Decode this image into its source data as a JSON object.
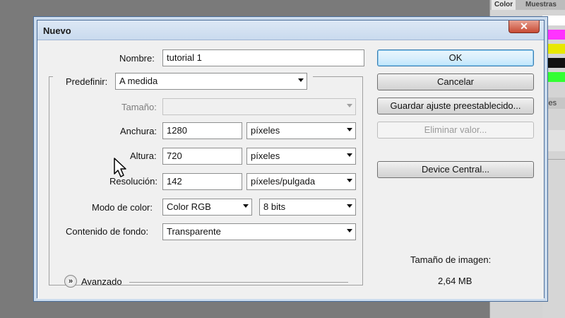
{
  "background_app": {
    "tabs": [
      "Color",
      "Muestras"
    ],
    "side_tab": "ales"
  },
  "dialog": {
    "title": "Nuevo",
    "close_symbol": "✕",
    "name": {
      "label": "Nombre:",
      "value": "tutorial 1"
    },
    "preset": {
      "label": "Predefinir:",
      "value": "A medida"
    },
    "size": {
      "label": "Tamaño:",
      "value": ""
    },
    "width": {
      "label": "Anchura:",
      "value": "1280",
      "unit": "píxeles"
    },
    "height": {
      "label": "Altura:",
      "value": "720",
      "unit": "píxeles"
    },
    "resolution": {
      "label": "Resolución:",
      "value": "142",
      "unit": "píxeles/pulgada"
    },
    "color_mode": {
      "label": "Modo de color:",
      "value": "Color RGB",
      "depth": "8 bits"
    },
    "background": {
      "label": "Contenido de fondo:",
      "value": "Transparente"
    },
    "advanced": {
      "label": "Avanzado",
      "icon": "chevron-double-down-icon"
    },
    "buttons": {
      "ok": "OK",
      "cancel": "Cancelar",
      "save_preset": "Guardar ajuste preestablecido...",
      "delete_preset": "Eliminar valor...",
      "device_central": "Device Central..."
    },
    "image_size": {
      "label": "Tamaño de imagen:",
      "value": "2,64 MB"
    }
  },
  "colors": {
    "swatches": [
      "#ffffff",
      "#ff33ff",
      "#e8e800",
      "#111111",
      "#33ff33"
    ],
    "title_bar": "#c9daee",
    "close_button": "#c74a34",
    "default_button": "#bee6fd"
  }
}
